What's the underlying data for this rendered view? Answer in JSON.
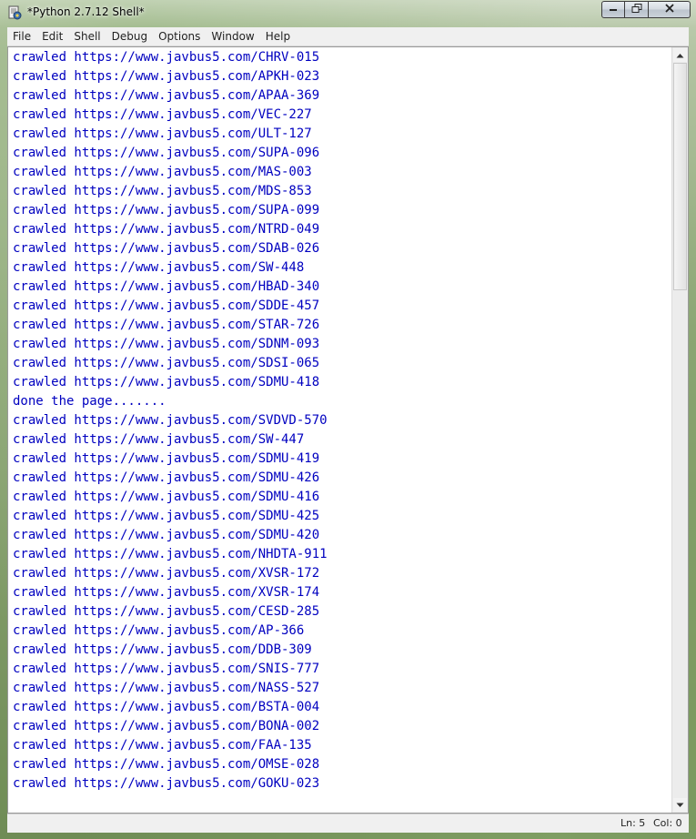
{
  "window": {
    "title": "*Python 2.7.12 Shell*",
    "icon": "python-idle-icon",
    "caption_buttons": {
      "minimize": "minimize-icon",
      "maximize": "maximize-icon",
      "close": "close-icon"
    }
  },
  "menu": [
    "File",
    "Edit",
    "Shell",
    "Debug",
    "Options",
    "Window",
    "Help"
  ],
  "output_color": "#0000c0",
  "lines": [
    "crawled https://www.javbus5.com/CHRV-015",
    "crawled https://www.javbus5.com/APKH-023",
    "crawled https://www.javbus5.com/APAA-369",
    "crawled https://www.javbus5.com/VEC-227",
    "crawled https://www.javbus5.com/ULT-127",
    "crawled https://www.javbus5.com/SUPA-096",
    "crawled https://www.javbus5.com/MAS-003",
    "crawled https://www.javbus5.com/MDS-853",
    "crawled https://www.javbus5.com/SUPA-099",
    "crawled https://www.javbus5.com/NTRD-049",
    "crawled https://www.javbus5.com/SDAB-026",
    "crawled https://www.javbus5.com/SW-448",
    "crawled https://www.javbus5.com/HBAD-340",
    "crawled https://www.javbus5.com/SDDE-457",
    "crawled https://www.javbus5.com/STAR-726",
    "crawled https://www.javbus5.com/SDNM-093",
    "crawled https://www.javbus5.com/SDSI-065",
    "crawled https://www.javbus5.com/SDMU-418",
    "done the page.......",
    "crawled https://www.javbus5.com/SVDVD-570",
    "crawled https://www.javbus5.com/SW-447",
    "crawled https://www.javbus5.com/SDMU-419",
    "crawled https://www.javbus5.com/SDMU-426",
    "crawled https://www.javbus5.com/SDMU-416",
    "crawled https://www.javbus5.com/SDMU-425",
    "crawled https://www.javbus5.com/SDMU-420",
    "crawled https://www.javbus5.com/NHDTA-911",
    "crawled https://www.javbus5.com/XVSR-172",
    "crawled https://www.javbus5.com/XVSR-174",
    "crawled https://www.javbus5.com/CESD-285",
    "crawled https://www.javbus5.com/AP-366",
    "crawled https://www.javbus5.com/DDB-309",
    "crawled https://www.javbus5.com/SNIS-777",
    "crawled https://www.javbus5.com/NASS-527",
    "crawled https://www.javbus5.com/BSTA-004",
    "crawled https://www.javbus5.com/BONA-002",
    "crawled https://www.javbus5.com/FAA-135",
    "crawled https://www.javbus5.com/OMSE-028",
    "crawled https://www.javbus5.com/GOKU-023"
  ],
  "scrollbar": {
    "up_icon": "scroll-up-arrow-icon",
    "down_icon": "scroll-down-arrow-icon"
  },
  "status": {
    "line": "Ln: 5",
    "col": "Col: 0"
  }
}
